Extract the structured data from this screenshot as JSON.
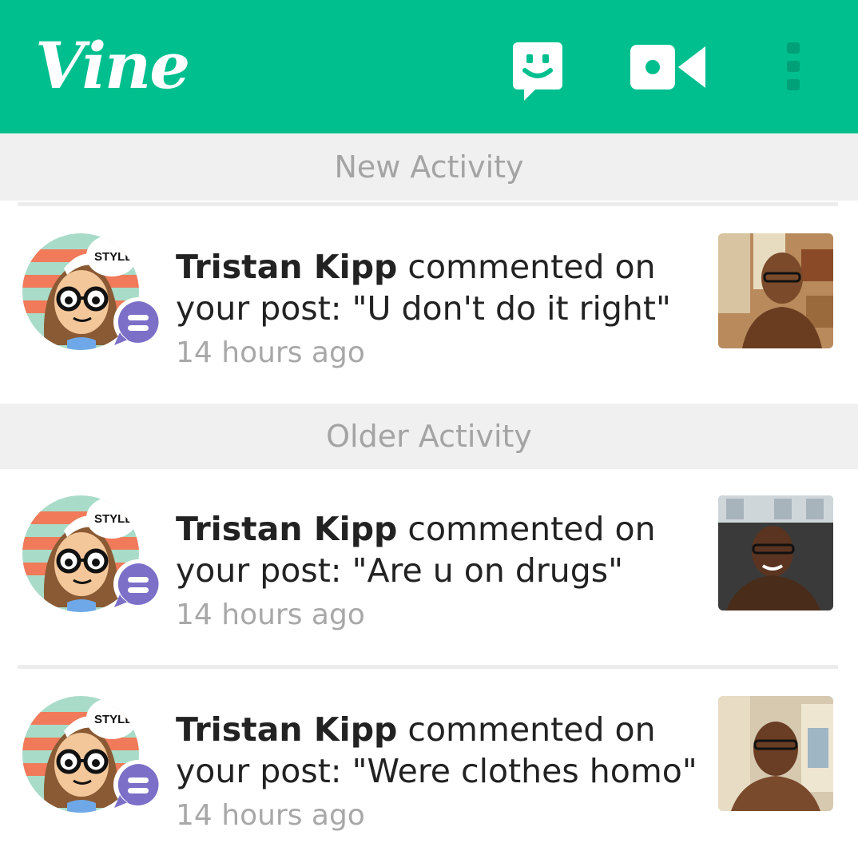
{
  "header": {
    "logo": "Vine",
    "icons": [
      "chat-face-icon",
      "video-camera-icon",
      "overflow-menu-icon"
    ]
  },
  "sections": {
    "new": "New Activity",
    "older": "Older Activity"
  },
  "activities": [
    {
      "user": "Tristan Kipp",
      "action": " commented on",
      "line2": "your post: \"U don't do it right\"",
      "time": "14 hours ago"
    },
    {
      "user": "Tristan Kipp",
      "action": " commented on",
      "line2": "your post: \"Are u on drugs\"",
      "time": "14 hours ago"
    },
    {
      "user": "Tristan Kipp",
      "action": " commented on",
      "line2": "your post: \"Were clothes homo\"",
      "time": "14 hours ago"
    }
  ],
  "avatar_caption": "STYLE",
  "colors": {
    "brand": "#00bf8f",
    "badge": "#7b6fc8",
    "section_bg": "#f0f0f0"
  }
}
